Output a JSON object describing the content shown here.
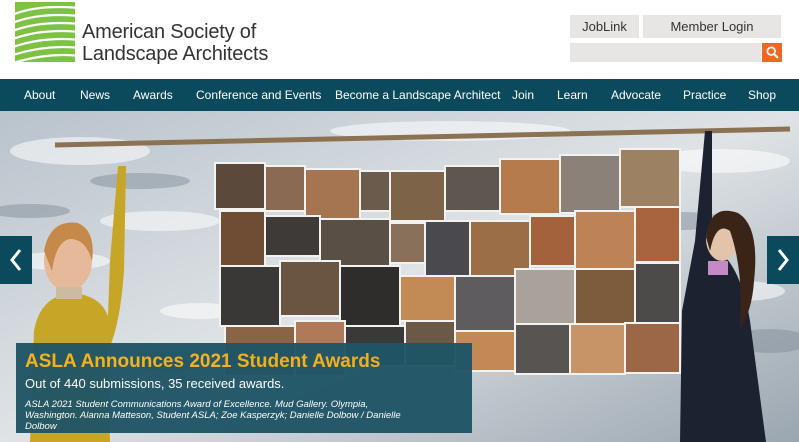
{
  "logo": {
    "line1": "American Society of",
    "line2": "Landscape Architects",
    "mark_color": "#7dc242"
  },
  "header": {
    "joblink_label": "JobLink",
    "member_login_label": "Member Login",
    "search_placeholder": "",
    "search_button_color": "#f26522"
  },
  "nav": {
    "bg_color": "#0b4a5c",
    "items": [
      {
        "label": "About"
      },
      {
        "label": "News"
      },
      {
        "label": "Awards"
      },
      {
        "label": "Conference and Events"
      },
      {
        "label": "Become a Landscape Architect"
      },
      {
        "label": "Join"
      },
      {
        "label": "Learn"
      },
      {
        "label": "Advocate"
      },
      {
        "label": "Practice"
      },
      {
        "label": "Shop"
      }
    ]
  },
  "hero": {
    "title": "ASLA Announces 2021 Student Awards",
    "subtitle": "Out of 440 submissions, 35 received awards.",
    "credit": "ASLA 2021 Student Communications Award of Excellence. Mud Gallery. Olympia, Washington. Alanna Matteson, Student ASLA; Zoe Kasperzyk; Danielle Dolbow / Danielle Dolbow",
    "title_color": "#f7b21a",
    "caption_bg": "#1f5566"
  },
  "carousel": {
    "prev_icon": "chevron-left-icon",
    "next_icon": "chevron-right-icon"
  }
}
